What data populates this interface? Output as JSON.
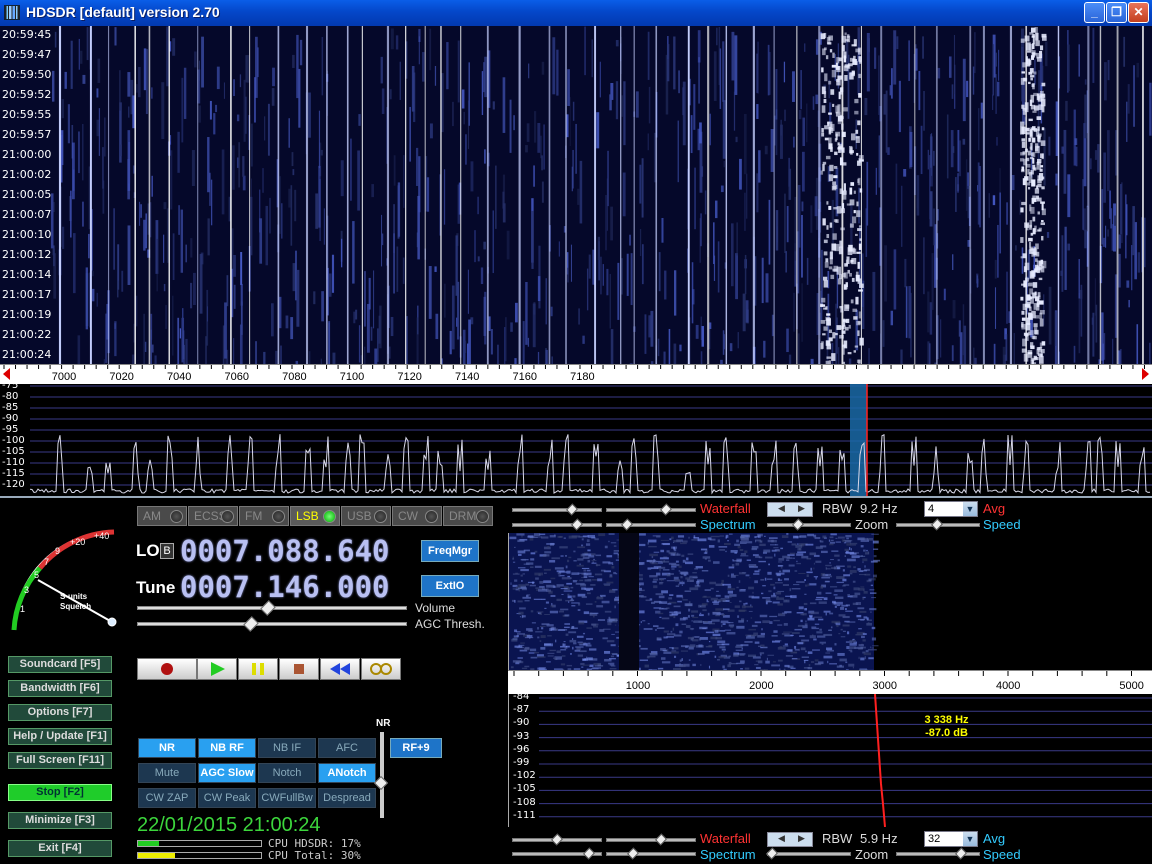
{
  "window": {
    "title": "HDSDR [default]  version 2.70"
  },
  "waterfall_times": [
    "20:59:45",
    "20:59:47",
    "20:59:50",
    "20:59:52",
    "20:59:55",
    "20:59:57",
    "21:00:00",
    "21:00:02",
    "21:00:05",
    "21:00:07",
    "21:00:10",
    "21:00:12",
    "21:00:14",
    "21:00:17",
    "21:00:19",
    "21:00:22",
    "21:00:24"
  ],
  "freq_axis": [
    "7000",
    "7020",
    "7040",
    "7060",
    "7080",
    "7100",
    "7120",
    "7140",
    "7160",
    "7180"
  ],
  "spectrum_db": [
    "-75",
    "-80",
    "-85",
    "-90",
    "-95",
    "-100",
    "-105",
    "-110",
    "-115",
    "-120"
  ],
  "modes": [
    {
      "label": "AM",
      "active": false
    },
    {
      "label": "ECSS",
      "active": false
    },
    {
      "label": "FM",
      "active": false
    },
    {
      "label": "LSB",
      "active": true
    },
    {
      "label": "USB",
      "active": false
    },
    {
      "label": "CW",
      "active": false
    },
    {
      "label": "DRM",
      "active": false
    }
  ],
  "smeter": {
    "scale": [
      "1",
      "3",
      "5",
      "7",
      "9",
      "+20",
      "+40"
    ],
    "caption_1": "S-units",
    "caption_2": "Squelch"
  },
  "lo": {
    "label": "LO",
    "badge": "B",
    "value": "0007.088.640"
  },
  "tune": {
    "label": "Tune",
    "value": "0007.146.000"
  },
  "freqmgr": "FreqMgr",
  "extio": "ExtIO",
  "volume_label": "Volume",
  "agc_label": "AGC Thresh.",
  "left_buttons": [
    {
      "label": "Soundcard  [F5]"
    },
    {
      "label": "Bandwidth  [F6]"
    },
    {
      "label": "Options    [F7]"
    },
    {
      "label": "Help / Update  [F1]"
    },
    {
      "label": "Full Screen  [F11]"
    },
    {
      "label": "Stop          [F2]"
    },
    {
      "label": "Minimize   [F3]"
    },
    {
      "label": "Exit           [F4]"
    }
  ],
  "nr_label": "NR",
  "rf_button": "RF+9",
  "dsp_buttons": [
    {
      "label": "NR",
      "on": true
    },
    {
      "label": "NB RF",
      "on": true
    },
    {
      "label": "NB IF",
      "on": false
    },
    {
      "label": "AFC",
      "on": false
    },
    {
      "label": "Mute",
      "on": false
    },
    {
      "label": "AGC Slow",
      "on": true
    },
    {
      "label": "Notch",
      "on": false
    },
    {
      "label": "ANotch",
      "on": true
    },
    {
      "label": "CW ZAP",
      "on": false
    },
    {
      "label": "CW Peak",
      "on": false
    },
    {
      "label": "CWFullBw",
      "on": false
    },
    {
      "label": "Despread",
      "on": false
    }
  ],
  "datetime": "22/01/2015 21:00:24",
  "cpu": {
    "hdsdr_label": "CPU HDSDR:  17%",
    "total_label": "CPU Total:  30%",
    "hdsdr": 0.17,
    "total": 0.3
  },
  "rf_controls": {
    "waterfall": "Waterfall",
    "spectrum": "Spectrum",
    "rbw_label": "RBW",
    "rbw": "9.2 Hz",
    "zoom": "Zoom",
    "avg": "Avg",
    "speed": "Speed",
    "avg_value": "4"
  },
  "af_controls": {
    "waterfall": "Waterfall",
    "spectrum": "Spectrum",
    "rbw_label": "RBW",
    "rbw": "5.9 Hz",
    "zoom": "Zoom",
    "avg": "Avg",
    "speed": "Speed",
    "avg_value": "32"
  },
  "af_axis": [
    "1000",
    "2000",
    "3000",
    "4000",
    "5000"
  ],
  "af_db": [
    "-84",
    "-87",
    "-90",
    "-93",
    "-96",
    "-99",
    "-102",
    "-105",
    "-108",
    "-111"
  ],
  "af_readout": {
    "freq": "3 338 Hz",
    "level": "-87.0 dB"
  },
  "colors": {
    "accent": "#1e74c8",
    "lcd": "#b9c0f2",
    "active_led": "#00aa00",
    "marker": "#ff2020"
  }
}
